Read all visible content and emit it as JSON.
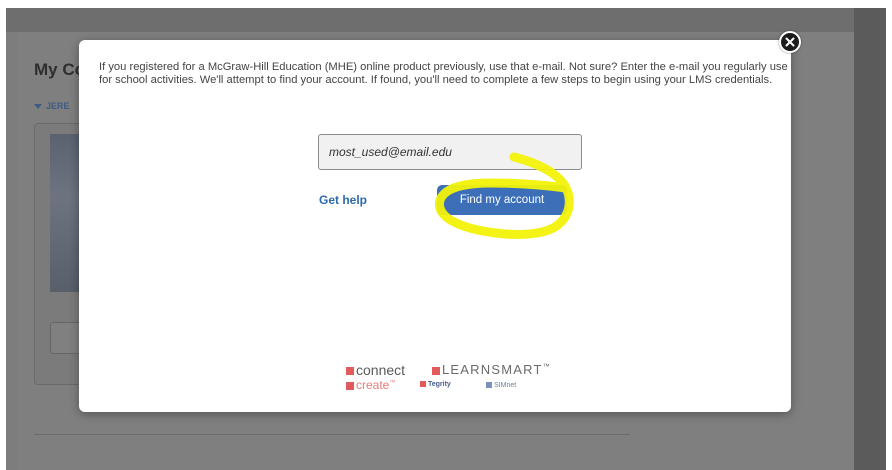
{
  "background": {
    "page_title_fragment": "My Co",
    "user_fragment": "JERE"
  },
  "modal": {
    "message": "If you registered for a McGraw-Hill Education (MHE) online product previously, use that e-mail. Not sure? Enter the e-mail you regularly use for school activities. We'll attempt to find your account. If found, you'll need to complete a few steps to begin using your LMS credentials.",
    "email": {
      "value": "most_used@email.edu",
      "placeholder": ""
    },
    "get_help_label": "Get help",
    "find_account_label": "Find my account",
    "close_icon": "close-icon"
  },
  "logos": {
    "connect": "connect",
    "learnsmart": "LEARNSMART",
    "learnsmart_mark": "™",
    "create": "create",
    "create_mark": "™",
    "tegrity": "Tegrity",
    "simnet": "SIMnet"
  },
  "colors": {
    "primary_button": "#3d6fb8",
    "link": "#2f6aa8",
    "highlight": "#f2f20a",
    "overlay": "#7f7f7f"
  }
}
